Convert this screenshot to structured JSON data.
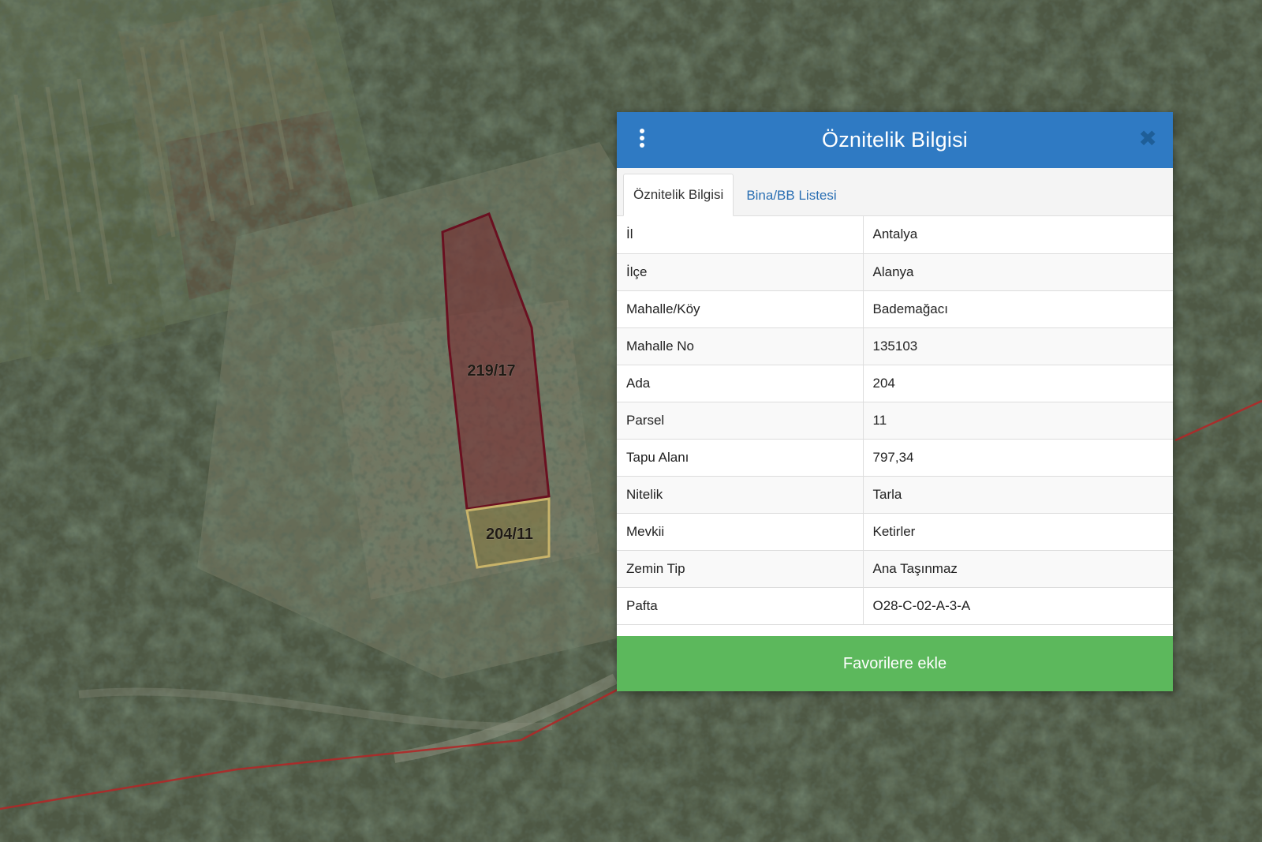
{
  "map": {
    "parcels": [
      {
        "label": "219/17"
      },
      {
        "label": "204/11"
      }
    ],
    "colors": {
      "parcel_selected_fill": "#7a1f2a",
      "parcel_selected_stroke": "#6a1020",
      "parcel_adjacent_fill": "#8a7a3a",
      "parcel_adjacent_stroke": "#c9b46a",
      "boundary_line": "#b02828"
    }
  },
  "panel": {
    "title": "Öznitelik Bilgisi",
    "menu_icon": "kebab-vertical-icon",
    "close_icon": "close-icon",
    "close_glyph": "✖",
    "tabs": [
      {
        "label": "Öznitelik Bilgisi",
        "active": true
      },
      {
        "label": "Bina/BB Listesi",
        "active": false
      }
    ],
    "rows": [
      {
        "key": "İl",
        "value": "Antalya"
      },
      {
        "key": "İlçe",
        "value": "Alanya"
      },
      {
        "key": "Mahalle/Köy",
        "value": "Bademağacı"
      },
      {
        "key": "Mahalle No",
        "value": "135103"
      },
      {
        "key": "Ada",
        "value": "204"
      },
      {
        "key": "Parsel",
        "value": "11"
      },
      {
        "key": "Tapu Alanı",
        "value": "797,34"
      },
      {
        "key": "Nitelik",
        "value": "Tarla"
      },
      {
        "key": "Mevkii",
        "value": "Ketirler"
      },
      {
        "key": "Zemin Tip",
        "value": "Ana Taşınmaz"
      },
      {
        "key": "Pafta",
        "value": "O28-C-02-A-3-A"
      }
    ],
    "favorite_button": "Favorilere ekle",
    "colors": {
      "header_bg": "#2f7ac3",
      "button_bg": "#5cb85c",
      "tab_link": "#2a6fb3"
    }
  }
}
